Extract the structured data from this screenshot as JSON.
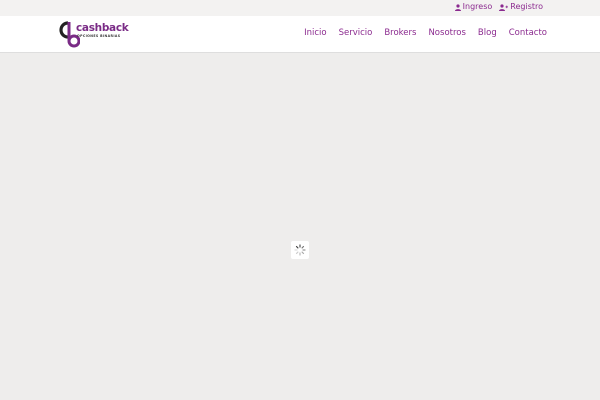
{
  "topbar": {
    "links": [
      {
        "label": "Ingreso",
        "icon": "user-icon"
      },
      {
        "label": "Registro",
        "icon": "user-plus-icon"
      }
    ]
  },
  "logo": {
    "name": "cashback",
    "tagline": "OPCIONES BINARIAS"
  },
  "nav": {
    "items": [
      "Inicio",
      "Servicio",
      "Brokers",
      "Nosotros",
      "Blog",
      "Contacto"
    ]
  },
  "colors": {
    "accent": "#8b2a8f",
    "background": "#eeedec"
  }
}
